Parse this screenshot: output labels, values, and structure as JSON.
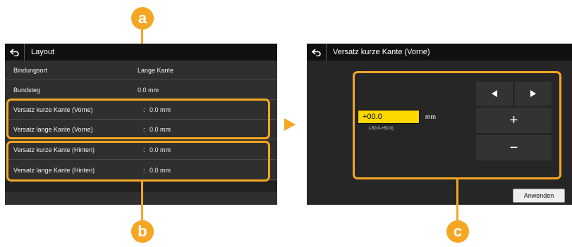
{
  "left_screen": {
    "title": "Layout",
    "rows": [
      {
        "label": "Bindungsort",
        "value": "Lange Kante"
      },
      {
        "label": "Bundsteg",
        "value": "0.0 mm"
      },
      {
        "label": "Versatz kurze Kante (Vorne)",
        "sep": ":",
        "value": "0.0 mm"
      },
      {
        "label": "Versatz lange Kante (Vorne)",
        "sep": ":",
        "value": "0.0 mm"
      },
      {
        "label": "Versatz kurze Kante (Hinten)",
        "sep": ":",
        "value": "0.0 mm"
      },
      {
        "label": "Versatz lange Kante (Hinten)",
        "sep": ":",
        "value": "0.0 mm"
      }
    ]
  },
  "right_screen": {
    "title": "Versatz kurze Kante (Vorne)",
    "input_value": "+00.0",
    "unit": "mm",
    "range_hint": "(-50.0-+50.0)",
    "plus_label": "+",
    "minus_label": "−",
    "apply_label": "Anwenden"
  },
  "callouts": {
    "a": "a",
    "b": "b",
    "c": "c"
  },
  "colors": {
    "accent": "#f5a623",
    "screen_bg": "#2f2f2f",
    "titlebar": "#111111",
    "input_bg": "#ffd700"
  },
  "icons": [
    "back-arrow-icon",
    "arrow-left-icon",
    "arrow-right-icon",
    "transition-arrow-icon"
  ]
}
